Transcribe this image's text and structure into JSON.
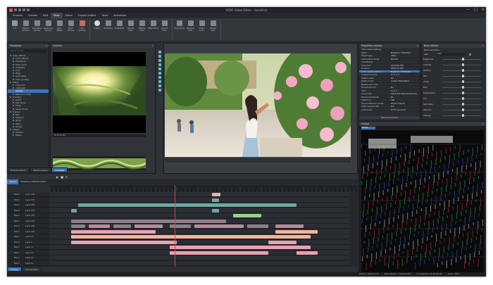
{
  "window": {
    "title": "VSDC Video Editor - Sunshine",
    "controls": [
      "—",
      "□",
      "✕"
    ]
  },
  "menu": [
    "Projects",
    "Scenes",
    "Edit",
    "View",
    "Editor",
    "Export project",
    "Tools",
    "Activation"
  ],
  "ribbon": {
    "groups": [
      {
        "label": "Windows layout",
        "buttons": [
          "Cut",
          "Objects explorer",
          "Properties window",
          "Resources window",
          "Basic effects",
          "Basic window",
          "Color grading"
        ]
      },
      {
        "label": "Scene windows",
        "buttons": [
          "Scopes",
          "Templates",
          "Snapshots",
          "Objects tools",
          "Editing tools",
          "Filters tools",
          "Layout tools"
        ]
      },
      {
        "label": "Toolbar windows",
        "buttons": [
          "Zoom tools",
          "Playback tools",
          "Cursor tools",
          "Mobile tools"
        ]
      }
    ]
  },
  "templates": {
    "title": "Templates",
    "search_placeholder": "Search in tree",
    "items": [
      "Video effects",
      "Audio effects",
      "Transitions",
      "Fade in/out",
      "Crossfade",
      "Push",
      "Wipe",
      "Light leaks",
      "Color grading",
      "Filters",
      "Cinematic",
      "Instagram",
      "Vintage",
      "Black and white",
      "Overlays",
      "Glitch",
      "Text styles",
      "Titles",
      "Lower thirds",
      "Frames",
      "Blur",
      "Sharpen",
      "Noise",
      "Retro",
      "Lenses",
      "Shapes",
      "Stickers",
      "Masks"
    ],
    "selected_index": 12
  },
  "sources": {
    "title": "Sources",
    "timecode": "00:00:02.416"
  },
  "properties": {
    "title": "Properties window",
    "rows": [
      {
        "k": "Video object settings",
        "v": ""
      },
      {
        "k": "Name",
        "v": "Mediaclip_27060150"
      },
      {
        "k": "Object type",
        "v": "Video"
      },
      {
        "k": "Composition mode",
        "v": "Normal"
      },
      {
        "k": "Coordinates",
        "v": ""
      },
      {
        "k": "Time (ms)",
        "v": "00:00:00.000"
      },
      {
        "k": "Duration",
        "v": "00:00:12.625"
      },
      {
        "k": "Video object settings",
        "v": "Mediaclip_27060150"
      },
      {
        "k": "Cropped borders",
        "v": "0; 0; 0; 0"
      },
      {
        "k": "Stretch video",
        "v": "No"
      },
      {
        "k": "Resize mode",
        "v": "Linear interpolation"
      },
      {
        "k": "Background color",
        "v": ""
      },
      {
        "k": "Fill background",
        "v": "No"
      },
      {
        "k": "Color",
        "v": "0; 0; 0"
      },
      {
        "k": "Loop mode",
        "v": "Show last frame at the end"
      },
      {
        "k": "Playing backwards",
        "v": "No"
      },
      {
        "k": "Speed (%)",
        "v": "100"
      },
      {
        "k": "Sound stretching mode",
        "v": "Tempo change"
      },
      {
        "k": "Audio volume (dB)",
        "v": "0.0"
      },
      {
        "k": "Audio track",
        "v": "Don't use audio"
      }
    ],
    "footer": "Resources window"
  },
  "basic_effects": {
    "title": "Basic effects",
    "section": "Basic correction",
    "auto_label": "Auto",
    "auto_value": "Auto",
    "rows": [
      {
        "name": "Brightness",
        "value": 0.5
      },
      {
        "name": "Contrast",
        "value": 0.5
      },
      {
        "name": "Gamma",
        "value": 0.5
      },
      {
        "name": "Red",
        "value": 0.5
      },
      {
        "name": "Green",
        "value": 0.5
      },
      {
        "name": "Blue",
        "value": 0.5
      },
      {
        "name": "Temperature",
        "value": 0.5
      },
      {
        "name": "Tint",
        "value": 0.5
      },
      {
        "name": "Saturation",
        "value": 0.5
      },
      {
        "name": "Vibrance",
        "value": 0.5
      },
      {
        "name": "Sharpen",
        "value": 0.5
      }
    ]
  },
  "scopes": {
    "title": "Scopes",
    "mode": "Parade"
  },
  "timeline": {
    "tabs": [
      "Projects explorer",
      "Objects explorer",
      "Templates"
    ],
    "scene_label": "Scene 0",
    "clip_label": "Mediaclip_27060150_00017",
    "tracks": [
      {
        "blend": "Blend",
        "name": "Layer 186"
      },
      {
        "blend": "Blend",
        "name": "Layer 185"
      },
      {
        "blend": "Blend",
        "name": "Layer 188"
      },
      {
        "blend": "Blend",
        "name": "Layer 187"
      },
      {
        "blend": "Blend",
        "name": "Layer 183"
      },
      {
        "blend": "Blend",
        "name": "Layer 183"
      },
      {
        "blend": "Blend",
        "name": "Layer 186"
      },
      {
        "blend": "Blend",
        "name": "Layer 183"
      },
      {
        "blend": "Blend",
        "name": "Layer 15"
      },
      {
        "blend": "Blend",
        "name": "Layer 2"
      },
      {
        "blend": "Blend",
        "name": "Layer 11"
      },
      {
        "blend": "Blend",
        "name": "Layer 12"
      },
      {
        "blend": "Blend",
        "name": "Layer 13"
      },
      {
        "blend": "Blend",
        "name": "Layer 14"
      }
    ],
    "bottom_tabs": [
      "Timeline",
      "Color grading"
    ]
  },
  "status": {
    "position": "Position: 00:00:21.25",
    "start": "Start selection: 00:00:00.000",
    "end": "End selection: 00:00:00.000",
    "zoom": "Zoom: 100%"
  },
  "colors": {
    "accent": "#3b75b5",
    "clip_teal": "#6fa7a4",
    "clip_pink": "#e9a0b3",
    "clip_salmon": "#f3b49b",
    "clip_green": "#9bd089"
  }
}
